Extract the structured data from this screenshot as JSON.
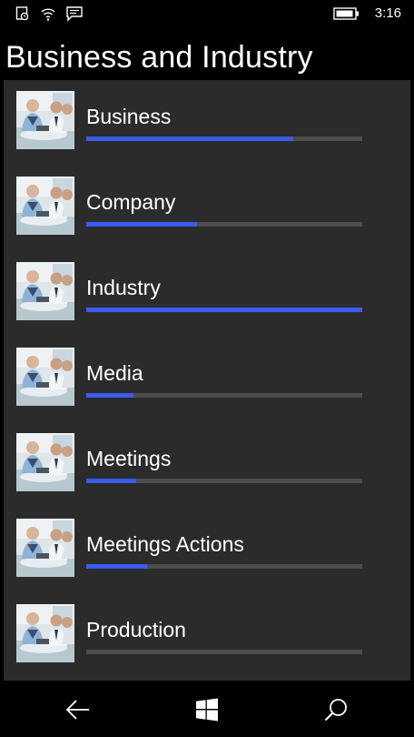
{
  "status_bar": {
    "time": "3:16",
    "icons": [
      "quiet-hours-icon",
      "wifi-icon",
      "message-icon",
      "battery-icon"
    ]
  },
  "page": {
    "title": "Business and Industry"
  },
  "list": {
    "items": [
      {
        "label": "Business",
        "progress": 0.75,
        "thumbnail": "business-people-photo"
      },
      {
        "label": "Company",
        "progress": 0.4,
        "thumbnail": "business-people-photo"
      },
      {
        "label": "Industry",
        "progress": 1.0,
        "thumbnail": "business-people-photo"
      },
      {
        "label": "Media",
        "progress": 0.17,
        "thumbnail": "business-people-photo"
      },
      {
        "label": "Meetings",
        "progress": 0.18,
        "thumbnail": "business-people-photo"
      },
      {
        "label": "Meetings Actions",
        "progress": 0.22,
        "thumbnail": "business-people-photo"
      },
      {
        "label": "Production",
        "progress": 0.0,
        "thumbnail": "business-people-photo"
      }
    ]
  },
  "nav_bar": {
    "buttons": [
      "back-icon",
      "windows-start-icon",
      "search-icon"
    ]
  },
  "colors": {
    "background": "#000000",
    "panel": "#2b2b2b",
    "accent": "#3a5cf0",
    "track": "#4d4d4d",
    "text": "#ffffff"
  }
}
